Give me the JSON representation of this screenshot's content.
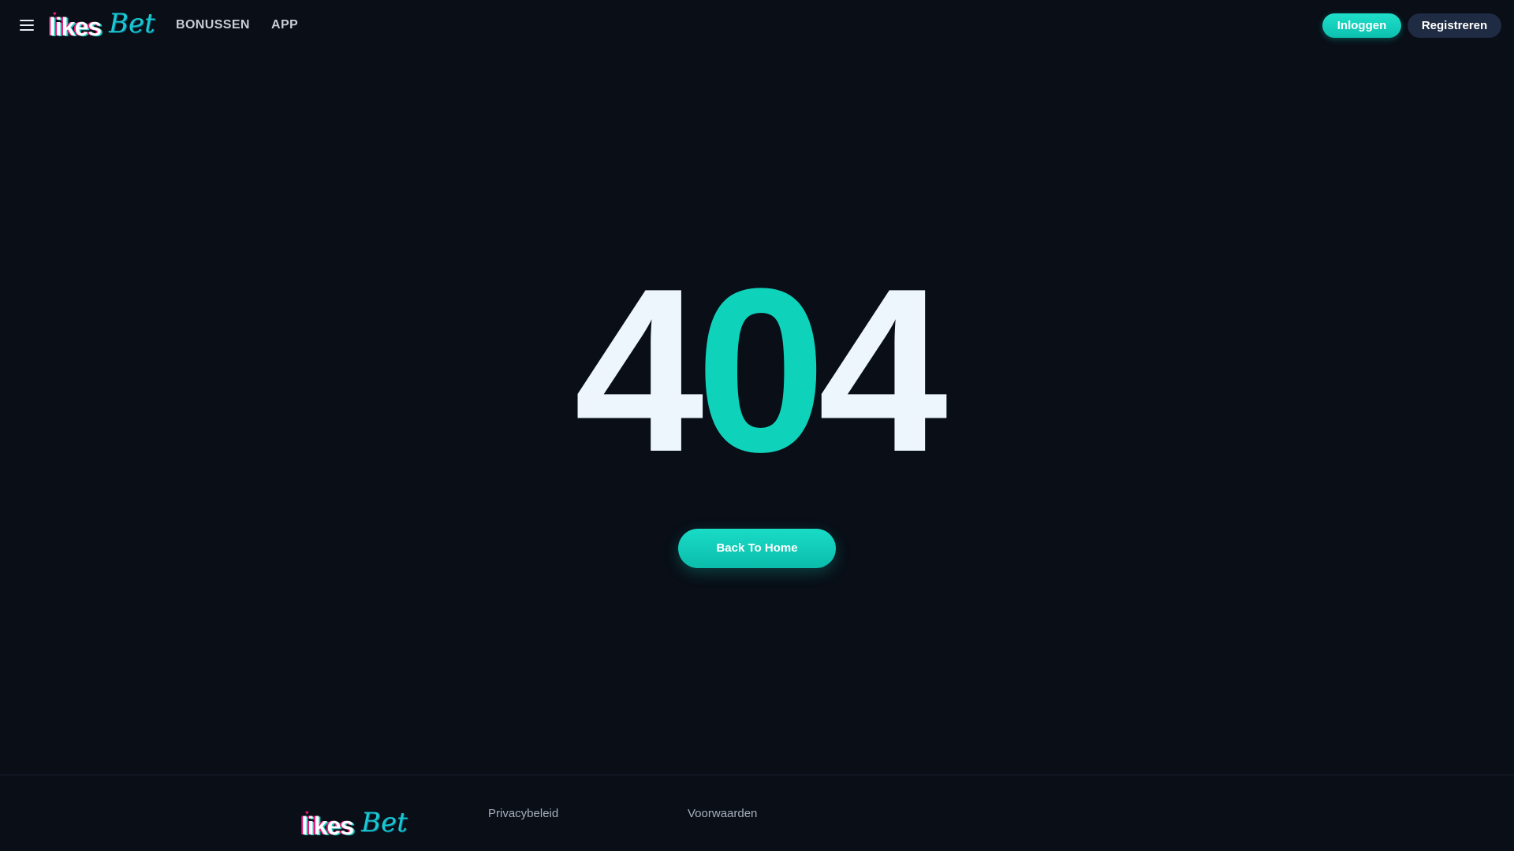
{
  "header": {
    "menu_icon": "hamburger-menu-icon",
    "logo": {
      "part1": "likes",
      "part2": "Bet"
    },
    "nav": [
      {
        "label": "BONUSSEN"
      },
      {
        "label": "APP"
      }
    ],
    "login_label": "Inloggen",
    "register_label": "Registreren"
  },
  "error": {
    "digits": [
      "4",
      "0",
      "4"
    ],
    "button_label": "Back To Home"
  },
  "footer": {
    "logo": {
      "part1": "likes",
      "part2": "Bet"
    },
    "links": [
      {
        "label": "Privacybeleid"
      },
      {
        "label": "Voorwaarden"
      }
    ]
  },
  "colors": {
    "background": "#090e17",
    "accent": "#0fd2bb",
    "register_button": "#1f2b42",
    "digit_light": "#eef6fd"
  }
}
